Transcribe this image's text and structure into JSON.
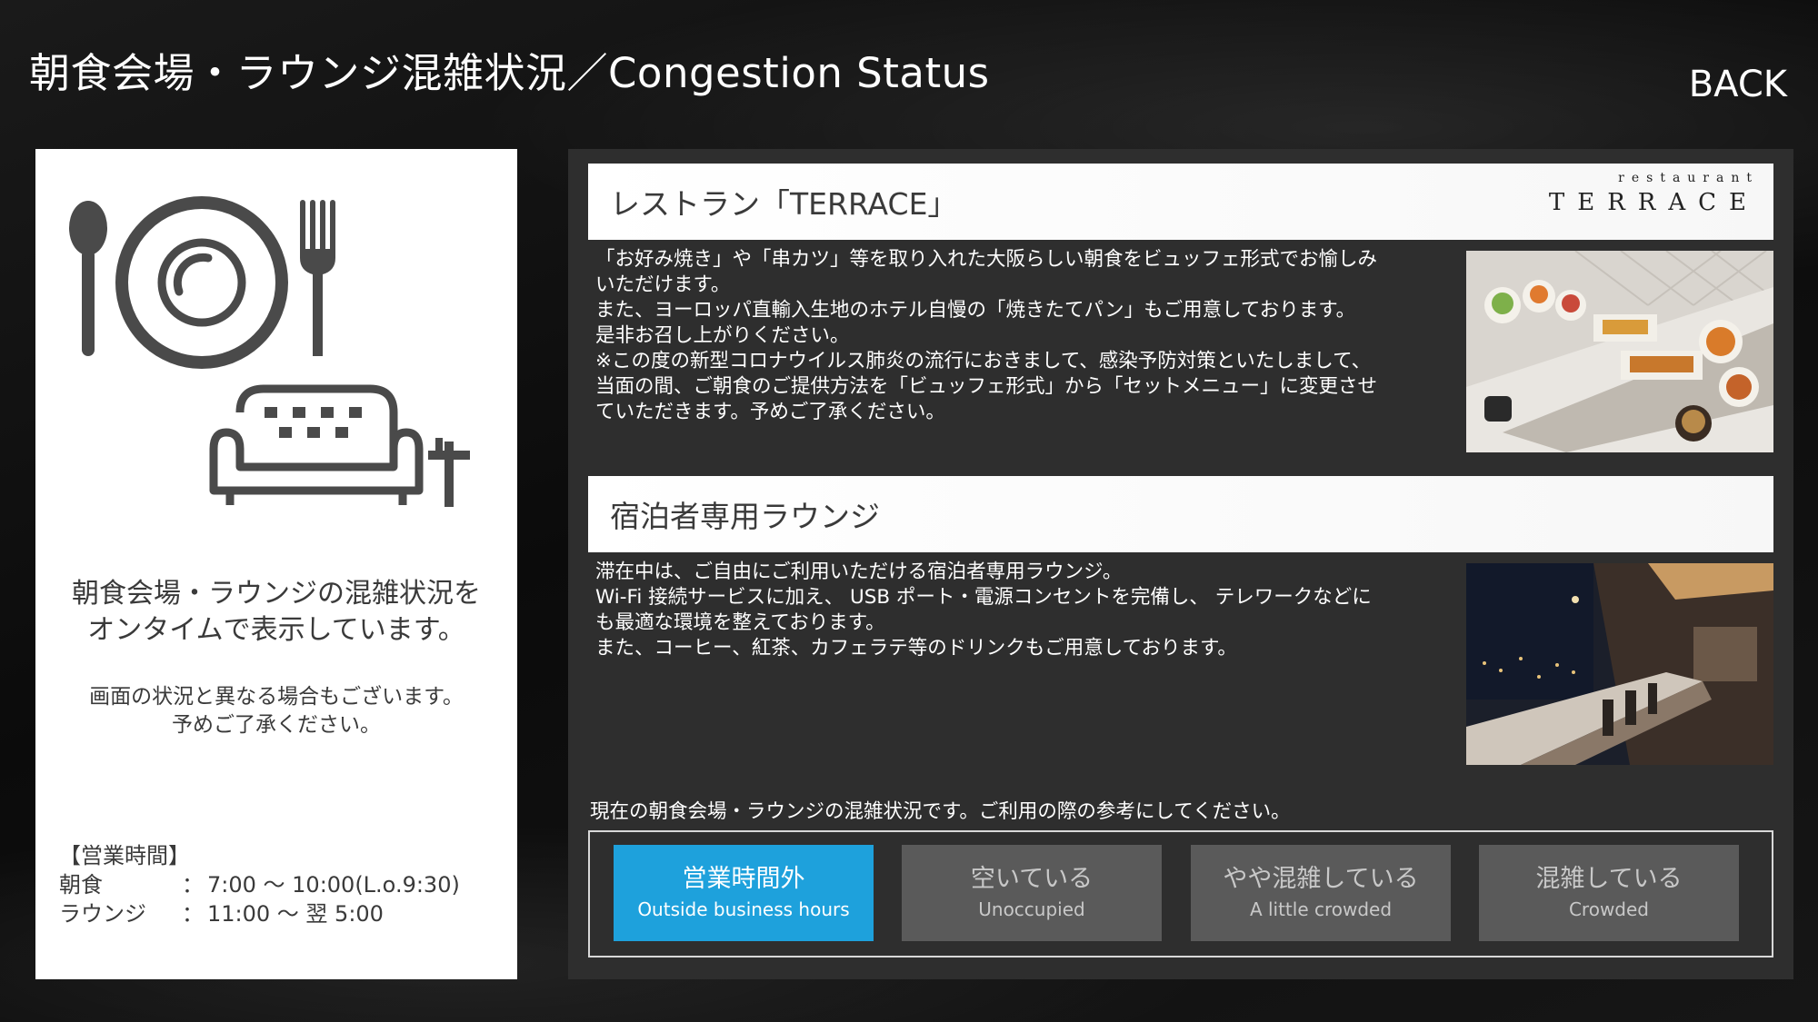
{
  "header": {
    "title": "朝食会場・ラウンジ混雑状況／Congestion Status",
    "back_label": "BACK"
  },
  "left_panel": {
    "main_text": "朝食会場・ラウンジの混雑状況を\nオンタイムで表示しています。",
    "note_text": "画面の状況と異なる場合もございます。\n予めご了承ください。",
    "hours_title": "【営業時間】",
    "hours": [
      {
        "label": "朝食",
        "sep": "：",
        "value": "7:00 ～ 10:00(L.o.9:30)"
      },
      {
        "label": "ラウンジ",
        "sep": "：",
        "value": "11:00 ～ 翌 5:00"
      }
    ],
    "icons": [
      "spoon-icon",
      "plate-icon",
      "fork-icon",
      "sofa-icon",
      "table-icon"
    ]
  },
  "restaurant": {
    "title": "レストラン「TERRACE」",
    "logo_small": "restaurant",
    "logo_big": "TERRACE",
    "description": "「お好み焼き」や「串カツ」等を取り入れた大阪らしい朝食をビュッフェ形式でお愉しみ\nいただけます。\nまた、ヨーロッパ直輸入生地のホテル自慢の「焼きたてパン」もご用意しております。\n是非お召し上がりください。\n※この度の新型コロナウイルス肺炎の流行におきまして、感染予防対策といたしまして、\n当面の間、ご朝食のご提供方法を「ビュッフェ形式」から「セットメニュー」に変更させ\nていただきます。予めご了承ください。"
  },
  "lounge": {
    "title": "宿泊者専用ラウンジ",
    "description": "滞在中は、ご自由にご利用いただける宿泊者専用ラウンジ。\nWi-Fi 接続サービスに加え、 USB ポート・電源コンセントを完備し、 テレワークなどに\nも最適な環境を整えております。\nまた、コーヒー、紅茶、カフェラテ等のドリンクもご用意しております。"
  },
  "status": {
    "caption": "現在の朝食会場・ラウンジの混雑状況です。ご利用の際の参考にしてください。",
    "items": [
      {
        "jp": "営業時間外",
        "en": "Outside business hours",
        "active": true
      },
      {
        "jp": "空いている",
        "en": "Unoccupied",
        "active": false
      },
      {
        "jp": "やや混雑している",
        "en": "A little crowded",
        "active": false
      },
      {
        "jp": "混雑している",
        "en": "Crowded",
        "active": false
      }
    ],
    "active_color": "#1ea1dc",
    "inactive_color": "#5a5a5a"
  }
}
